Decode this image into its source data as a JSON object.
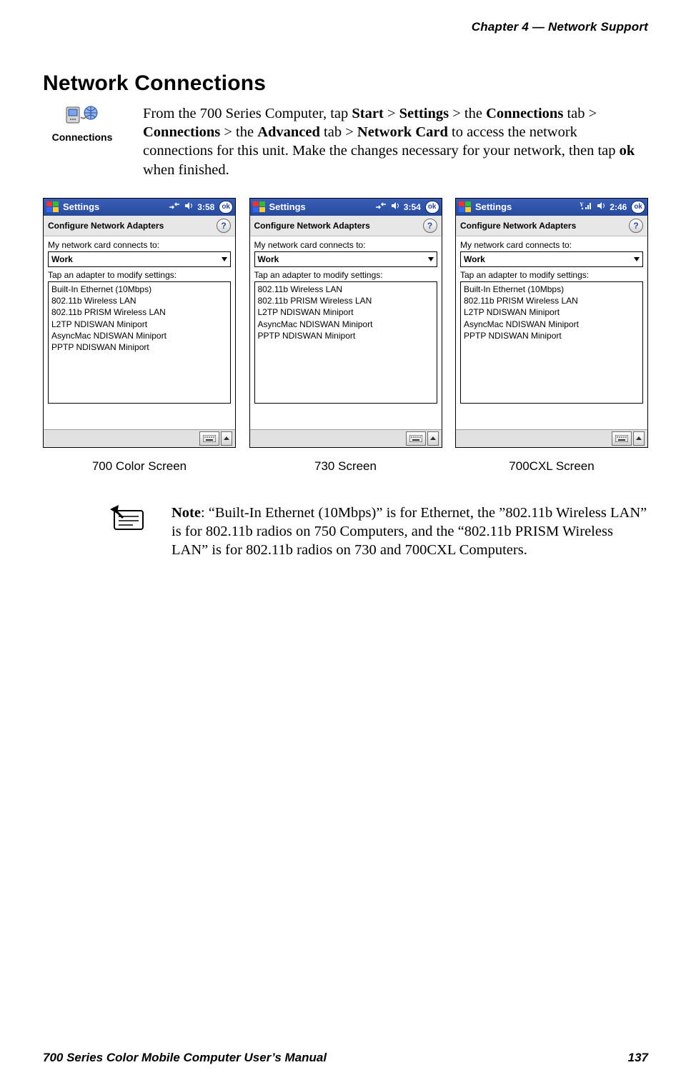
{
  "header": {
    "running_head": "Chapter  4  —  Network Support"
  },
  "section": {
    "title": "Network Connections"
  },
  "icon": {
    "label": "Connections"
  },
  "intro": {
    "pre": "From the 700 Series Computer, tap ",
    "start": "Start",
    "gt1": " > ",
    "settings": "Settings",
    "gt2": " > the ",
    "connections_tab": "Connections",
    "post_tab": " tab > ",
    "connections": "Connections",
    "gt3": " > the ",
    "advanced": "Advanced",
    "gt4": " tab > ",
    "network_card": "Network Card",
    "tail1": " to access the net­work connections for this unit. Make the changes necessary for your net­work, then tap ",
    "ok": "ok",
    "tail2": " when finished."
  },
  "panes": [
    {
      "task_title": "Settings",
      "time": "3:58",
      "subtitle": "Configure Network Adapters",
      "connects_label": "My network card connects to:",
      "dropdown_value": "Work",
      "tap_label": "Tap an adapter to modify settings:",
      "adapters": [
        "Built-In Ethernet (10Mbps)",
        "802.11b Wireless LAN",
        "802.11b PRISM Wireless LAN",
        "L2TP NDISWAN Miniport",
        "AsyncMac NDISWAN Miniport",
        "PPTP NDISWAN Miniport"
      ],
      "ok": "ok",
      "caption": "700 Color Screen",
      "signal_icon": "net-arrows"
    },
    {
      "task_title": "Settings",
      "time": "3:54",
      "subtitle": "Configure Network Adapters",
      "connects_label": "My network card connects to:",
      "dropdown_value": "Work",
      "tap_label": "Tap an adapter to modify settings:",
      "adapters": [
        "802.11b Wireless LAN",
        "802.11b PRISM Wireless LAN",
        "L2TP NDISWAN Miniport",
        "AsyncMac NDISWAN Miniport",
        "PPTP NDISWAN Miniport"
      ],
      "ok": "ok",
      "caption": "730 Screen",
      "signal_icon": "net-arrows"
    },
    {
      "task_title": "Settings",
      "time": "2:46",
      "subtitle": "Configure Network Adapters",
      "connects_label": "My network card connects to:",
      "dropdown_value": "Work",
      "tap_label": "Tap an adapter to modify settings:",
      "adapters": [
        "Built-In Ethernet (10Mbps)",
        "802.11b PRISM Wireless LAN",
        "L2TP NDISWAN Miniport",
        "AsyncMac NDISWAN Miniport",
        "PPTP NDISWAN Miniport"
      ],
      "ok": "ok",
      "caption": "700CXL Screen",
      "signal_icon": "wifi-bars"
    }
  ],
  "note": {
    "label": "Note",
    "body": ": “Built-In Ethernet (10Mbps)” is for Ethernet, the ”802.11b Wire­less LAN” is for 802.11b radios on 750 Computers, and the “802.11b PRISM Wireless LAN” is for 802.11b radios on 730 and 700CXL Com­puters."
  },
  "footer": {
    "left": "700 Series Color Mobile Computer User’s Manual",
    "right": "137"
  }
}
